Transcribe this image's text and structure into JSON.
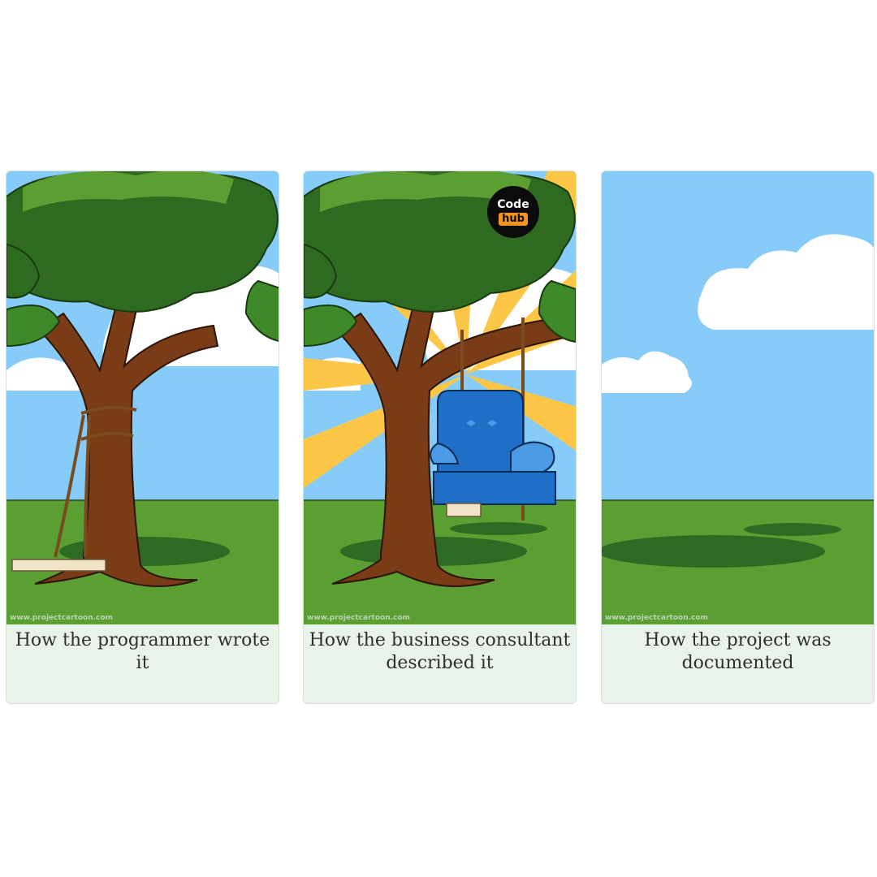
{
  "panels": [
    {
      "caption": "How the programmer wrote it",
      "watermark": "www.projectcartoon.com",
      "scene": "tree-with-rope-tied-around-trunk"
    },
    {
      "caption": "How the business consultant described it",
      "watermark": "www.projectcartoon.com",
      "scene": "tree-with-armchair-swing-and-sunburst",
      "badge": {
        "top": "Code",
        "bottom": "hub"
      }
    },
    {
      "caption": "How the project was documented",
      "watermark": "www.projectcartoon.com",
      "scene": "empty-field"
    }
  ],
  "colors": {
    "sky": "#87ccf8",
    "grass": "#5b9e32",
    "foliage": "#2e6a20",
    "trunk": "#7a3c16",
    "sun": "#fcc747",
    "chair": "#1f6fc6",
    "badge_accent": "#f7941d"
  }
}
